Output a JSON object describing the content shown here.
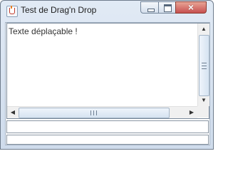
{
  "window": {
    "title": "Test de Drag'n Drop",
    "icon": "java-cup-icon",
    "controls": {
      "minimize": "minimize-icon",
      "maximize": "maximize-icon",
      "close": "×"
    }
  },
  "content": {
    "textarea_text": "Texte déplaçable !",
    "scroll_arrows": {
      "up": "▲",
      "down": "▼",
      "left": "◀",
      "right": "▶"
    },
    "field1_value": "",
    "field2_value": ""
  },
  "colors": {
    "title_bar": "#dbe6f3",
    "close_button": "#c75050",
    "frame_border": "#6f7c8c"
  }
}
